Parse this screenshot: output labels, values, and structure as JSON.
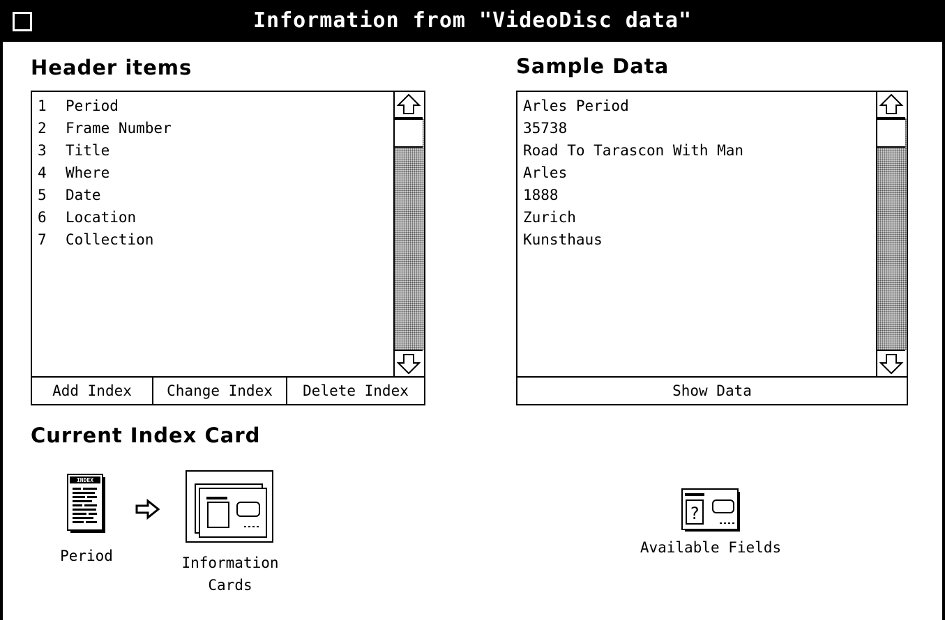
{
  "window": {
    "title": "Information from \"VideoDisc data\""
  },
  "header_items": {
    "heading": "Header items",
    "items": [
      {
        "num": "1",
        "label": "Period"
      },
      {
        "num": "2",
        "label": "Frame Number"
      },
      {
        "num": "3",
        "label": "Title"
      },
      {
        "num": "4",
        "label": "Where"
      },
      {
        "num": "5",
        "label": "Date"
      },
      {
        "num": "6",
        "label": "Location"
      },
      {
        "num": "7",
        "label": "Collection"
      }
    ],
    "buttons": {
      "add": "Add Index",
      "change": "Change Index",
      "delete": "Delete Index"
    }
  },
  "sample_data": {
    "heading": "Sample Data",
    "items": [
      "Arles Period",
      "35738",
      "Road To Tarascon With Man",
      "Arles",
      "1888",
      "Zurich",
      "Kunsthaus"
    ],
    "show_button": "Show Data"
  },
  "current_index_card": {
    "heading": "Current Index Card",
    "index_icon_text": "INDEX",
    "index_label": "Period",
    "cards_label": "Information\nCards"
  },
  "available_fields": {
    "icon_glyph": "?",
    "label": "Available Fields"
  }
}
